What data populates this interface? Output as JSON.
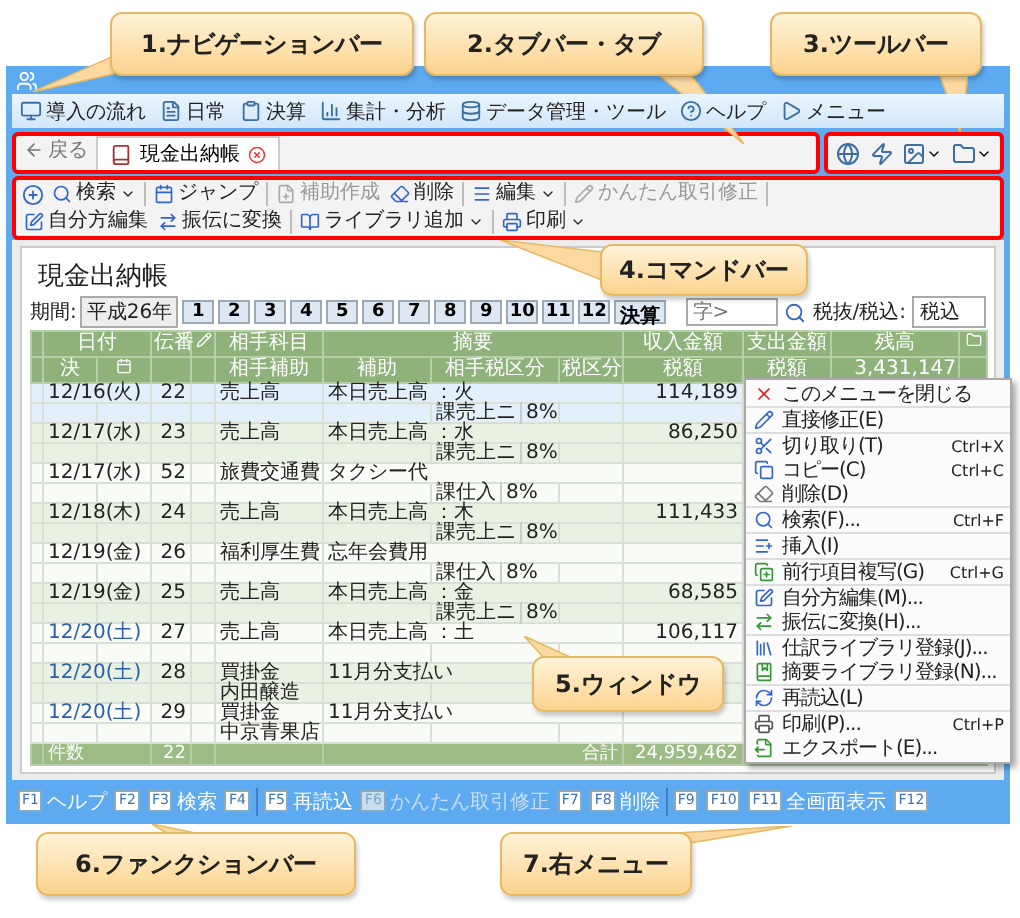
{
  "navigation": [
    {
      "label": "導入の流れ"
    },
    {
      "label": "日常"
    },
    {
      "label": "決算"
    },
    {
      "label": "集計・分析"
    },
    {
      "label": "データ管理・ツール"
    },
    {
      "label": "ヘルプ"
    },
    {
      "label": "メニュー"
    }
  ],
  "tab_bar": {
    "back": "戻る",
    "tabs": [
      {
        "label": "現金出納帳",
        "selected": true
      }
    ]
  },
  "toolbar": [
    {
      "dropdown": false
    },
    {
      "dropdown": false
    },
    {
      "dropdown": true
    },
    {
      "dropdown": true
    }
  ],
  "command_bar": [
    [
      {
        "label": "検索",
        "dropdown": true,
        "disabled": false
      }
    ],
    [
      {
        "label": "ジャンプ",
        "dropdown": false,
        "disabled": false
      }
    ],
    [
      {
        "label": "補助作成",
        "dropdown": false,
        "disabled": true
      },
      {
        "label": "削除",
        "dropdown": false,
        "disabled": false
      }
    ],
    [
      {
        "label": "編集",
        "dropdown": true,
        "disabled": false
      }
    ],
    [
      {
        "label": "かんたん取引修正",
        "dropdown": false,
        "disabled": true
      }
    ],
    [
      {
        "label": "自分方編集",
        "dropdown": false,
        "disabled": false
      },
      {
        "label": "振伝に変換",
        "dropdown": false,
        "disabled": false
      }
    ],
    [
      {
        "label": "ライブラリ追加",
        "dropdown": true,
        "disabled": false
      }
    ],
    [
      {
        "label": "印刷",
        "dropdown": true,
        "disabled": false
      }
    ]
  ],
  "panel": {
    "title": "現金出納帳",
    "period_label": "期間:",
    "year": "平成26年",
    "periods": [
      "1",
      "2",
      "3",
      "4",
      "5",
      "6",
      "7",
      "8",
      "9",
      "10",
      "11",
      "12",
      "決算"
    ],
    "search": {
      "placeholder": "字>"
    },
    "tax_label": "税抜/税込:",
    "tax_mode": "税込"
  },
  "table": {
    "columns": {
      "date": "日付",
      "settled": "決",
      "number": "伝番",
      "account": "相手科目",
      "memo": "摘要",
      "income": "収入金額",
      "expense": "支出金額",
      "balance": "残高",
      "sub_account": "相手補助",
      "sub": "補助",
      "partner_tax": "相手税区分",
      "tax": "税区分",
      "income_tax": "税額",
      "expense_tax": "税額",
      "opening_balance": "3,431,147"
    },
    "rows": [
      {
        "date": "12/16(火)",
        "number": "22",
        "account": "売上高",
        "memo": "本日売上高 ：火",
        "income": "114,189",
        "tax_class": "課売上ニ",
        "tax_rate": "8%",
        "weekend": false,
        "selected": true
      },
      {
        "date": "12/17(水)",
        "number": "23",
        "account": "売上高",
        "memo": "本日売上高 ：水",
        "income": "86,250",
        "tax_class": "課売上ニ",
        "tax_rate": "8%",
        "weekend": false,
        "selected": false
      },
      {
        "date": "12/17(水)",
        "number": "52",
        "account": "旅費交通費",
        "memo": "タクシー代",
        "tax_class": "課仕入",
        "tax_rate": "8%",
        "weekend": false,
        "selected": false
      },
      {
        "date": "12/18(木)",
        "number": "24",
        "account": "売上高",
        "memo": "本日売上高 ：木",
        "income": "111,433",
        "tax_class": "課売上ニ",
        "tax_rate": "8%",
        "weekend": false,
        "selected": false
      },
      {
        "date": "12/19(金)",
        "number": "26",
        "account": "福利厚生費",
        "memo": "忘年会費用",
        "tax_class": "課仕入",
        "tax_rate": "8%",
        "weekend": false,
        "selected": false
      },
      {
        "date": "12/19(金)",
        "number": "25",
        "account": "売上高",
        "memo": "本日売上高 ：金",
        "income": "68,585",
        "tax_class": "課売上ニ",
        "tax_rate": "8%",
        "weekend": false,
        "selected": false
      },
      {
        "date": "12/20(土)",
        "number": "27",
        "account": "売上高",
        "memo": "本日売上高 ：土",
        "income": "106,117",
        "weekend": true,
        "selected": false
      },
      {
        "date": "12/20(土)",
        "number": "28",
        "account": "買掛金",
        "memo": "11月分支払い",
        "sub_account": "内田醸造",
        "weekend": true,
        "selected": false
      },
      {
        "date": "12/20(土)",
        "number": "29",
        "account": "買掛金",
        "memo": "11月分支払い",
        "sub_account": "中京青果店",
        "weekend": true,
        "selected": false
      }
    ],
    "footer": {
      "count_label": "件数",
      "count": "22",
      "total_label": "合計",
      "total": "24,959,462"
    }
  },
  "context_menu": [
    [
      {
        "label": "このメニューを閉じる"
      }
    ],
    [
      {
        "label": "直接修正(E)"
      }
    ],
    [
      {
        "label": "切り取り(T)",
        "shortcut": "Ctrl+X"
      },
      {
        "label": "コピー(C)",
        "shortcut": "Ctrl+C"
      },
      {
        "label": "削除(D)"
      }
    ],
    [
      {
        "label": "検索(F)...",
        "shortcut": "Ctrl+F"
      }
    ],
    [
      {
        "label": "挿入(I)"
      }
    ],
    [
      {
        "label": "前行項目複写(G)",
        "shortcut": "Ctrl+G"
      }
    ],
    [
      {
        "label": "自分方編集(M)..."
      },
      {
        "label": "振伝に変換(H)..."
      }
    ],
    [
      {
        "label": "仕訳ライブラリ登録(J)..."
      },
      {
        "label": "摘要ライブラリ登録(N)..."
      }
    ],
    [
      {
        "label": "再読込(L)"
      }
    ],
    [
      {
        "label": "印刷(P)...",
        "shortcut": "Ctrl+P"
      },
      {
        "label": "エクスポート(E)..."
      }
    ]
  ],
  "function_bar": [
    [
      {
        "key": "F1",
        "label": "ヘルプ",
        "disabled": false
      },
      {
        "key": "F2",
        "disabled": false
      },
      {
        "key": "F3",
        "label": "検索",
        "disabled": false
      },
      {
        "key": "F4",
        "disabled": false
      }
    ],
    [
      {
        "key": "F5",
        "label": "再読込",
        "disabled": false
      },
      {
        "key": "F6",
        "label": "かんたん取引修正",
        "disabled": true
      },
      {
        "key": "F7",
        "disabled": false
      },
      {
        "key": "F8",
        "label": "削除",
        "disabled": false
      }
    ],
    [
      {
        "key": "F9",
        "disabled": false
      },
      {
        "key": "F10",
        "disabled": false
      },
      {
        "key": "F11",
        "label": "全画面表示",
        "disabled": false
      },
      {
        "key": "F12",
        "disabled": false
      }
    ]
  ],
  "callouts": [
    "1.ナビゲーションバー",
    "2.タブバー・タブ",
    "3.ツールバー",
    "4.コマンドバー",
    "5.ウィンドウ",
    "6.ファンクションバー",
    "7.右メニュー"
  ]
}
